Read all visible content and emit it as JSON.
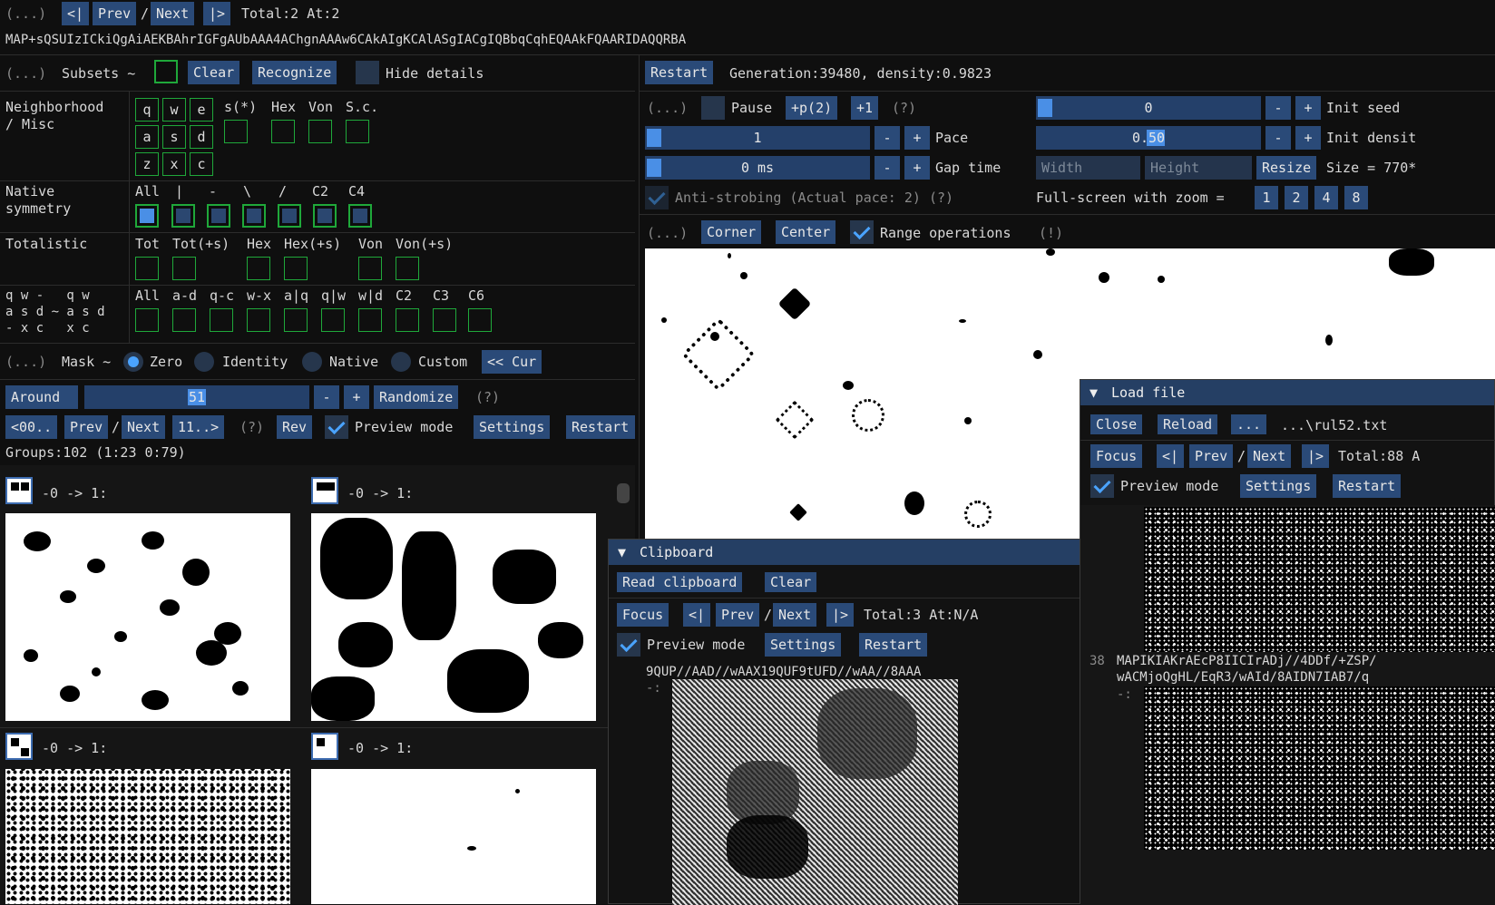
{
  "top_bar": {
    "collapse": "(...)",
    "first": "<|",
    "prev": "Prev",
    "slash": "/",
    "next": "Next",
    "last": "|>",
    "status": "Total:2 At:2"
  },
  "rule_string": "MAP+sQSUIzICkiQgAiAEKBAhrIGFgAUbAAA4AChgnAAAw6CAkAIgKCAlASgIACgIQBbqCqhEQAAkFQAARIDAQQRBA",
  "subsets": {
    "collapse": "(...)",
    "label": "Subsets ~",
    "clear": "Clear",
    "recognize": "Recognize",
    "hide_details": "Hide details"
  },
  "neighborhood": {
    "label1": "Neighborhood",
    "label2": "/ Misc",
    "keys": [
      "q",
      "w",
      "e",
      "a",
      "s",
      "d",
      "z",
      "x",
      "c"
    ],
    "extra_headers": [
      "s(*)",
      "Hex",
      "Von",
      "S.c."
    ]
  },
  "native_symmetry": {
    "label1": "Native",
    "label2": "symmetry",
    "headers": [
      "All",
      "|",
      "-",
      "\\",
      "/",
      "C2",
      "C4"
    ]
  },
  "totalistic": {
    "label": "Totalistic",
    "headers": [
      "Tot",
      "Tot(+s)",
      "Hex",
      "Hex(+s)",
      "Von",
      "Von(+s)"
    ]
  },
  "qwe_group": {
    "lines": [
      "q w -   q w",
      "a s d ~ a s d",
      "- x c   x c"
    ],
    "headers": [
      "All",
      "a-d",
      "q-c",
      "w-x",
      "a|q",
      "q|w",
      "w|d",
      "C2",
      "C3",
      "C6"
    ]
  },
  "mask": {
    "collapse": "(...)",
    "label": "Mask ~",
    "zero": "Zero",
    "identity": "Identity",
    "native": "Native",
    "custom": "Custom",
    "cur": "<< Cur"
  },
  "around": {
    "label": "Around",
    "value": "51",
    "minus": "-",
    "plus": "+",
    "randomize": "Randomize",
    "help": "(?)"
  },
  "nav_row": {
    "first": "<00..",
    "prev": "Prev",
    "slash": "/",
    "next": "Next",
    "last": "11..>",
    "help": "(?)",
    "rev": "Rev",
    "preview": "Preview mode",
    "settings": "Settings",
    "restart": "Restart"
  },
  "groups_status": "Groups:102 (1:23 0:79)",
  "group_items": [
    {
      "label": "-0 -> 1:"
    },
    {
      "label": "-0 -> 1:"
    },
    {
      "label": "-0 -> 1:"
    },
    {
      "label": "-0 -> 1:"
    }
  ],
  "sim": {
    "restart": "Restart",
    "status": "Generation:39480, density:0.9823",
    "collapse": "(...)",
    "pause": "Pause",
    "pplus": "+p(2)",
    "plus1": "+1",
    "help": "(?)",
    "pace_value": "1",
    "pace_label": "Pace",
    "gap_value": "0 ms",
    "gap_label": "Gap time",
    "anti_strobing": "Anti-strobing (Actual pace: 2) (?)",
    "seed_value": "0",
    "seed_label": "Init seed",
    "density_value": "0.50",
    "density_label": "Init densit",
    "width_ph": "Width",
    "height_ph": "Height",
    "resize": "Resize",
    "size_label": "Size = 770*",
    "fullscreen_label": "Full-screen with zoom =",
    "zoom": [
      "1",
      "2",
      "4",
      "8"
    ],
    "minus": "-",
    "plus": "+"
  },
  "canvas_bar": {
    "collapse": "(...)",
    "corner": "Corner",
    "center": "Center",
    "range_ops": "Range operations",
    "warn": "(!)"
  },
  "clipboard": {
    "title": "Clipboard",
    "read": "Read clipboard",
    "clear": "Clear",
    "focus": "Focus",
    "first": "<|",
    "prev": "Prev",
    "slash": "/",
    "next": "Next",
    "last": "|>",
    "status": "Total:3 At:N/A",
    "preview": "Preview mode",
    "settings": "Settings",
    "restart": "Restart",
    "rule_line": "9QUP//AAD//wAAX19QUF9tUFD//wAA//8AAA",
    "prefix": "-:"
  },
  "load_file": {
    "title": "Load file",
    "close": "Close",
    "reload": "Reload",
    "dots": "...",
    "path": "...\\rul52.txt",
    "focus": "Focus",
    "first": "<|",
    "prev": "Prev",
    "slash": "/",
    "next": "Next",
    "last": "|>",
    "status": "Total:88 A",
    "preview": "Preview mode",
    "settings": "Settings",
    "restart": "Restart",
    "index": "38",
    "rule_line1": "MAPIKIAKrAEcP8IICIrADj//4DDf/+ZSP/",
    "rule_line2": "wACMjoQgHL/EqR3/wAId/8AIDN7IAB7/q",
    "prefix": "-:"
  }
}
